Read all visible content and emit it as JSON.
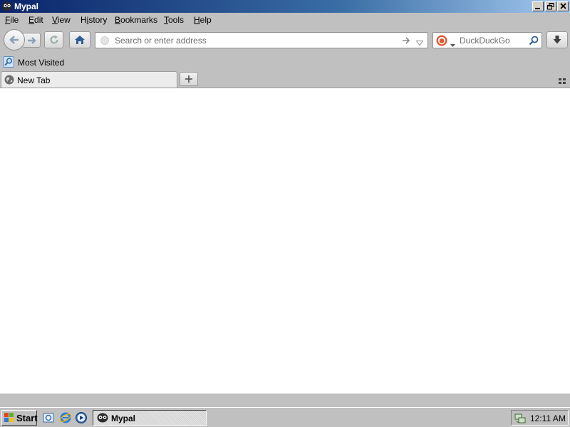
{
  "window": {
    "title": "Mypal",
    "controls": [
      "minimize",
      "restore",
      "close"
    ]
  },
  "menubar": {
    "items": [
      {
        "first": "F",
        "rest": "ile"
      },
      {
        "first": "E",
        "rest": "dit"
      },
      {
        "first": "V",
        "rest": "iew"
      },
      {
        "first": "",
        "rest": "History",
        "underline_index": 1
      },
      {
        "first": "B",
        "rest": "ookmarks"
      },
      {
        "first": "T",
        "rest": "ools"
      },
      {
        "first": "H",
        "rest": "elp"
      }
    ]
  },
  "navbar": {
    "url_placeholder": "Search or enter address",
    "url_value": "",
    "search_placeholder": "DuckDuckGo",
    "search_value": "",
    "icons": {
      "back": "back-arrow-icon",
      "forward": "forward-arrow-icon",
      "reload": "reload-icon",
      "home": "home-icon",
      "go": "go-arrow-icon",
      "history_dropdown": "dropdown-triangle-icon",
      "search_engine": "duckduckgo-icon",
      "search": "magnifier-icon",
      "downloads": "download-icon"
    }
  },
  "bookmarks": {
    "items": [
      {
        "label": "Most Visited"
      }
    ]
  },
  "tabs": {
    "items": [
      {
        "label": "New Tab",
        "active": true
      }
    ]
  },
  "taskbar": {
    "start_label": "Start",
    "tasks": [
      {
        "label": "Mypal"
      }
    ],
    "clock": "12:11 AM"
  },
  "colors": {
    "titlebar_start": "#0a246a",
    "titlebar_end": "#a6caf0",
    "chrome": "#c0c0c0",
    "content": "#ffffff"
  }
}
